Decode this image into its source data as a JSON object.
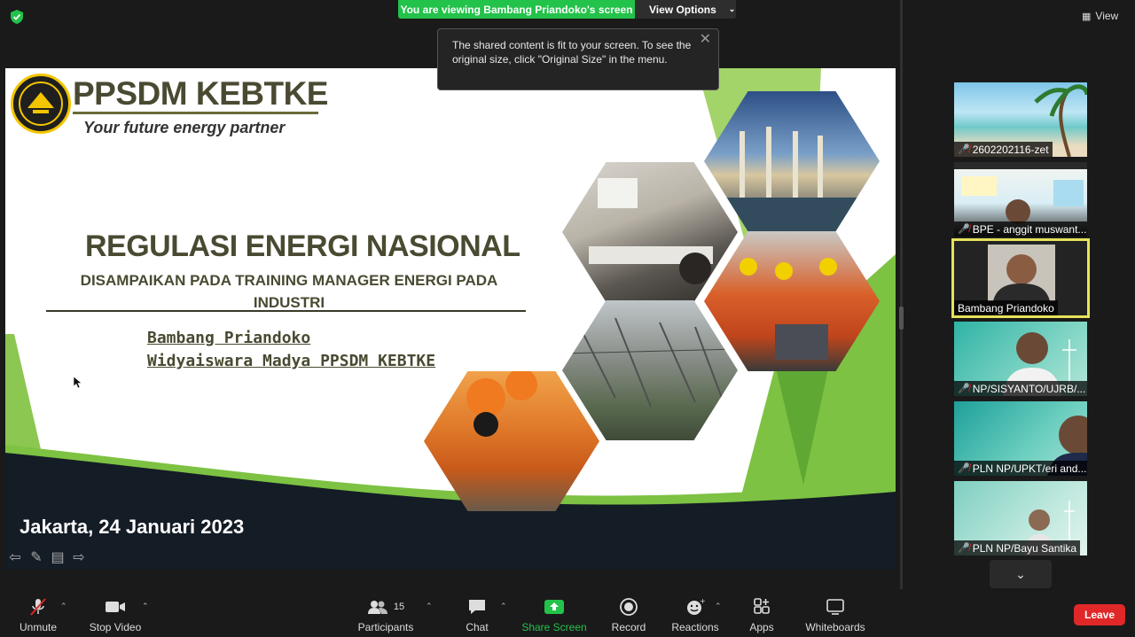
{
  "top_bar": {
    "viewing_banner": "You are viewing Bambang Priandoko's screen",
    "view_options_label": "View Options",
    "view_label": "View"
  },
  "tooltip": {
    "text": "The shared content is fit to your screen. To see the original size, click \"Original Size\" in the menu."
  },
  "slide": {
    "brand_title": "PPSDM KEBTKE",
    "tagline": "Your future energy partner",
    "main_title": "REGULASI ENERGI NASIONAL",
    "sub_title": "DISAMPAIKAN PADA TRAINING MANAGER ENERGI PADA INDUSTRI",
    "presenter_name": "Bambang Priandoko",
    "presenter_role": "Widyaiswara Madya PPSDM KEBTKE",
    "location_date": "Jakarta, 24 Januari 2023",
    "colors": {
      "accent_green": "#7dc242",
      "dark_band": "#141c26"
    }
  },
  "participants": [
    {
      "name": "2602202116-zet",
      "muted": true
    },
    {
      "name": "BPE - anggit muswant...",
      "muted": true
    },
    {
      "name": "Bambang Priandoko",
      "muted": false,
      "active_speaker": true
    },
    {
      "name": "NP/SISYANTO/UJRB/...",
      "muted": true
    },
    {
      "name": "PLN NP/UPKT/eri and...",
      "muted": true
    },
    {
      "name": "PLN NP/Bayu Santika",
      "muted": true
    }
  ],
  "toolbar": {
    "unmute": "Unmute",
    "stop_video": "Stop Video",
    "participants": "Participants",
    "participants_count": "15",
    "chat": "Chat",
    "share_screen": "Share Screen",
    "record": "Record",
    "reactions": "Reactions",
    "apps": "Apps",
    "whiteboards": "Whiteboards",
    "leave": "Leave"
  }
}
